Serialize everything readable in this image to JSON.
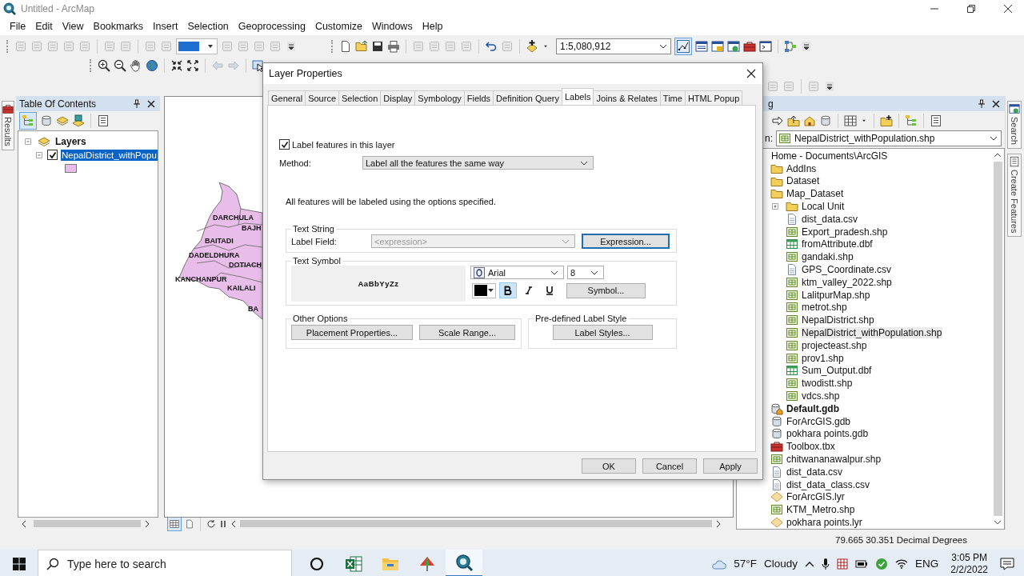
{
  "window": {
    "title": "Untitled - ArcMap"
  },
  "menu": [
    "File",
    "Edit",
    "View",
    "Bookmarks",
    "Insert",
    "Selection",
    "Geoprocessing",
    "Customize",
    "Windows",
    "Help"
  ],
  "toolbar": {
    "scale": "1:5,080,912"
  },
  "left_side_tabs": [
    "Results"
  ],
  "toc": {
    "title": "Table Of Contents",
    "tree": [
      {
        "label": "Layers",
        "expanded": true,
        "children": [
          {
            "label": "NepalDistrict_withPopu",
            "checked": true,
            "selected": true,
            "expanded": true,
            "color": "#e9bde9"
          }
        ]
      }
    ]
  },
  "map": {
    "labels": [
      "DARCHULA",
      "BAJH",
      "BAITADI",
      "DADELDHURA",
      "DOTIACH",
      "KANCHANPUR",
      "KAILALI",
      "BA"
    ]
  },
  "catalog": {
    "title": "g",
    "location_label": "n:",
    "location": "NepalDistrict_withPopulation.shp",
    "tree": [
      {
        "label": "Home - Documents\\ArcGIS",
        "kind": "home",
        "selected": false,
        "expanded": true,
        "children": [
          {
            "label": "AddIns",
            "kind": "folder",
            "selected": false
          },
          {
            "label": "Dataset",
            "kind": "folder",
            "selected": false
          },
          {
            "label": "Map_Dataset",
            "kind": "folder",
            "selected": false,
            "expanded": true,
            "children": [
              {
                "label": "Local Unit",
                "kind": "folder",
                "selected": false,
                "expanded": false
              },
              {
                "label": "dist_data.csv",
                "kind": "text",
                "selected": false
              },
              {
                "label": "Export_pradesh.shp",
                "kind": "shapefile",
                "selected": false
              },
              {
                "label": "fromAttribute.dbf",
                "kind": "table",
                "selected": false
              },
              {
                "label": "gandaki.shp",
                "kind": "shapefile",
                "selected": false
              },
              {
                "label": "GPS_Coordinate.csv",
                "kind": "text",
                "selected": false
              },
              {
                "label": "ktm_valley_2022.shp",
                "kind": "shapefile",
                "selected": false
              },
              {
                "label": "LalitpurMap.shp",
                "kind": "shapefile",
                "selected": false
              },
              {
                "label": "metrot.shp",
                "kind": "shapefile",
                "selected": false
              },
              {
                "label": "NepalDistrict.shp",
                "kind": "shapefile",
                "selected": false
              },
              {
                "label": "NepalDistrict_withPopulation.shp",
                "kind": "shapefile",
                "selected": true
              },
              {
                "label": "projecteast.shp",
                "kind": "shapefile",
                "selected": false
              },
              {
                "label": "prov1.shp",
                "kind": "shapefile",
                "selected": false
              },
              {
                "label": "Sum_Output.dbf",
                "kind": "table",
                "selected": false
              },
              {
                "label": "twodistt.shp",
                "kind": "shapefile",
                "selected": false
              },
              {
                "label": "vdcs.shp",
                "kind": "shapefile",
                "selected": false
              }
            ]
          },
          {
            "label": "Default.gdb",
            "kind": "default-geodatabase",
            "selected": false
          },
          {
            "label": "ForArcGIS.gdb",
            "kind": "geodatabase",
            "selected": false
          },
          {
            "label": "pokhara points.gdb",
            "kind": "geodatabase",
            "selected": false
          },
          {
            "label": "Toolbox.tbx",
            "kind": "toolbox",
            "selected": false
          },
          {
            "label": "chitwananawalpur.shp",
            "kind": "shapefile",
            "selected": false
          },
          {
            "label": "dist_data.csv",
            "kind": "text",
            "selected": false
          },
          {
            "label": "dist_data_class.csv",
            "kind": "text",
            "selected": false
          },
          {
            "label": "ForArcGIS.lyr",
            "kind": "layer",
            "selected": false
          },
          {
            "label": "KTM_Metro.shp",
            "kind": "shapefile",
            "selected": false
          },
          {
            "label": "pokhara points.lyr",
            "kind": "layer",
            "selected": false
          }
        ]
      }
    ]
  },
  "right_side_tabs": [
    "Search",
    "Create Features"
  ],
  "dialog": {
    "title": "Layer Properties",
    "tabs": [
      {
        "label": "General",
        "selected": false
      },
      {
        "label": "Source",
        "selected": false
      },
      {
        "label": "Selection",
        "selected": false
      },
      {
        "label": "Display",
        "selected": false
      },
      {
        "label": "Symbology",
        "selected": false
      },
      {
        "label": "Fields",
        "selected": false
      },
      {
        "label": "Definition Query",
        "selected": false
      },
      {
        "label": "Labels",
        "selected": true
      },
      {
        "label": "Joins & Relates",
        "selected": false
      },
      {
        "label": "Time",
        "selected": false
      },
      {
        "label": "HTML Popup",
        "selected": false
      }
    ],
    "label_features": {
      "label": "Label features in this layer",
      "checked": true
    },
    "method": {
      "label": "Method:",
      "value": "Label all the features the same way"
    },
    "info": "All features will be labeled using the options specified.",
    "text_string": {
      "title": "Text String",
      "field_label": "Label Field:",
      "field_value": "<expression>",
      "field_disabled": true,
      "button": "Expression..."
    },
    "text_symbol": {
      "title": "Text Symbol",
      "preview": "AaBbYyZz",
      "font": "Arial",
      "size": "8",
      "color": "#000000",
      "bold": true,
      "italic": false,
      "underline": false,
      "button": "Symbol..."
    },
    "other_options": {
      "title": "Other Options",
      "buttons": [
        "Placement Properties...",
        "Scale Range..."
      ]
    },
    "predefined": {
      "title": "Pre-defined Label Style",
      "button": "Label Styles..."
    },
    "buttons": [
      "OK",
      "Cancel",
      "Apply"
    ]
  },
  "status_bar": {
    "coordinates": "79.665  30.351 Decimal Degrees"
  },
  "taskbar": {
    "search_placeholder": "Type here to search",
    "apps": [
      {
        "kind": "circle",
        "selected": false
      },
      {
        "kind": "spreadsheet",
        "selected": false
      },
      {
        "kind": "folder",
        "selected": false
      },
      {
        "kind": "umbrella",
        "selected": false
      },
      {
        "kind": "globe",
        "selected": true
      }
    ],
    "temperature": "57°F",
    "weather": "Cloudy",
    "language": "ENG",
    "time": "3:05 PM",
    "date": "2/2/2022"
  }
}
